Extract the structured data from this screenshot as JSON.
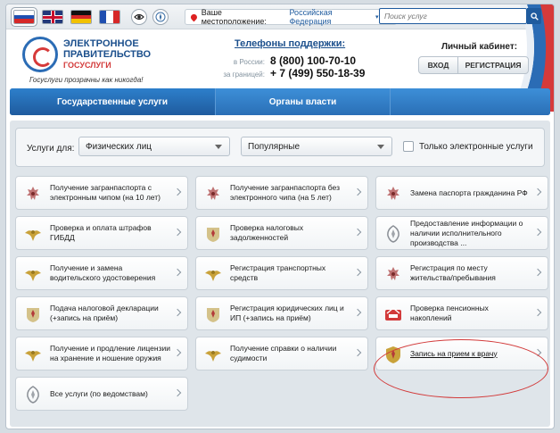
{
  "top_bar": {
    "languages": [
      "ru",
      "gb",
      "de",
      "fr"
    ],
    "location_label": "Ваше местоположение:",
    "location_value": "Российская Федерация",
    "help_label": "?"
  },
  "header": {
    "logo_line1": "ЭЛЕКТРОННОЕ",
    "logo_line2": "ПРАВИТЕЛЬСТВО",
    "logo_line3": "ГОСУСЛУГИ",
    "slogan": "Госуслуги прозрачны как никогда!",
    "support_title": "Телефоны поддержки:",
    "phone_russia_label": "в России:",
    "phone_russia": "8 (800) 100-70-10",
    "phone_abroad_label": "за границей:",
    "phone_abroad": "+ 7 (499) 550-18-39",
    "cabinet_title": "Личный кабинет:",
    "login_label": "ВХОД",
    "register_label": "РЕГИСТРАЦИЯ"
  },
  "nav": {
    "tab_services": "Государственные услуги",
    "tab_authorities": "Органы власти",
    "search_placeholder": "Поиск услуг"
  },
  "filter": {
    "label": "Услуги для:",
    "audience": "Физических лиц",
    "sort": "Популярные",
    "electronic_only": "Только электронные услуги"
  },
  "services": [
    {
      "label": "Получение загранпаспорта с электронным чипом (на 10 лет)",
      "icon": "passport-emblem-icon"
    },
    {
      "label": "Получение загранпаспорта без электронного чипа (на 5 лет)",
      "icon": "passport-emblem-icon"
    },
    {
      "label": "Замена паспорта гражданина РФ",
      "icon": "passport-emblem-icon"
    },
    {
      "label": "Проверка и оплата штрафов ГИБДД",
      "icon": "eagle-emblem-icon"
    },
    {
      "label": "Проверка налоговых задолженностей",
      "icon": "tax-emblem-icon"
    },
    {
      "label": "Предоставление информации о наличии исполнительного производства ...",
      "icon": "bailiff-emblem-icon"
    },
    {
      "label": "Получение и замена водительского удостоверения",
      "icon": "eagle-emblem-icon"
    },
    {
      "label": "Регистрация транспортных средств",
      "icon": "eagle-emblem-icon"
    },
    {
      "label": "Регистрация по месту жительства/пребывания",
      "icon": "passport-emblem-icon"
    },
    {
      "label": "Подача налоговой декларации (+запись на приём)",
      "icon": "tax-emblem-icon"
    },
    {
      "label": "Регистрация юридических лиц и ИП (+запись на приём)",
      "icon": "tax-emblem-icon"
    },
    {
      "label": "Проверка пенсионных накоплений",
      "icon": "pension-fund-icon"
    },
    {
      "label": "Получение и продление лицензии на хранение и ношение оружия",
      "icon": "eagle-emblem-icon"
    },
    {
      "label": "Получение справки о наличии судимости",
      "icon": "eagle-emblem-icon"
    },
    {
      "label": "Запись на прием к врачу",
      "icon": "doctor-emblem-icon"
    },
    {
      "label": "Все услуги (по ведомствам)",
      "icon": "bailiff-emblem-icon"
    }
  ],
  "colors": {
    "brand_blue": "#1f5b9e",
    "accent_red": "#d23a3a",
    "nav_blue": "#2a6fb6"
  }
}
